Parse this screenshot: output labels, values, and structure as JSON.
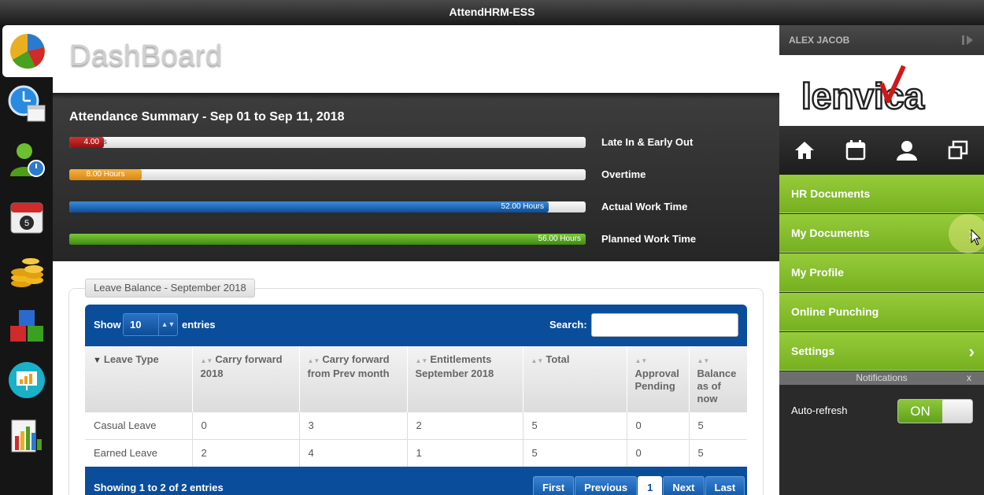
{
  "window": {
    "title": "AttendHRM-ESS"
  },
  "rail": {
    "items": [
      {
        "name": "dashboard-pie-icon"
      },
      {
        "name": "attendance-clock-icon"
      },
      {
        "name": "user-time-icon"
      },
      {
        "name": "calendar-icon"
      },
      {
        "name": "coins-icon"
      },
      {
        "name": "cubes-icon"
      },
      {
        "name": "presentation-icon"
      },
      {
        "name": "reports-chart-icon"
      }
    ]
  },
  "main": {
    "title": "DashBoard",
    "summary": {
      "title": "Attendance Summary - Sep 01 to Sep 11, 2018",
      "bars": [
        {
          "label": "Late In & Early Out",
          "value_text": "4.00",
          "ghost_text": "urs",
          "fraction": 0.045,
          "color": "#b01c1c"
        },
        {
          "label": "Overtime",
          "value_text": "8.00 Hours",
          "fraction": 0.14,
          "color": "#e89a20"
        },
        {
          "label": "Actual Work Time",
          "value_text": "52.00 Hours",
          "fraction": 0.928,
          "color": "#1660b8"
        },
        {
          "label": "Planned Work Time",
          "value_text": "56.00 Hours",
          "fraction": 1.0,
          "color": "#5aa820"
        }
      ]
    },
    "leave_balance": {
      "legend": "Leave Balance - September 2018",
      "show_label": "Show",
      "page_size": "10",
      "entries_label": "entries",
      "search_label": "Search:",
      "search_value": "",
      "columns": [
        "Leave Type",
        "Carry forward 2018",
        "Carry forward from Prev month",
        "Entitlements September 2018",
        "Total",
        "Approval Pending",
        "Balance as of now"
      ],
      "rows": [
        [
          "Casual Leave",
          "0",
          "3",
          "2",
          "5",
          "0",
          "5"
        ],
        [
          "Earned Leave",
          "2",
          "4",
          "1",
          "5",
          "0",
          "5"
        ]
      ],
      "footer_info": "Showing 1 to 2 of 2 entries",
      "pager": {
        "first": "First",
        "previous": "Previous",
        "current": "1",
        "next": "Next",
        "last": "Last"
      }
    }
  },
  "side": {
    "user_name": "ALEX JACOB",
    "logo_text": "lenvica",
    "nav": [
      {
        "label": "HR Documents",
        "chevron": ""
      },
      {
        "label": "My Documents",
        "chevron": "›"
      },
      {
        "label": "My Profile",
        "chevron": ""
      },
      {
        "label": "Online Punching",
        "chevron": ""
      },
      {
        "label": "Settings",
        "chevron": "›"
      }
    ],
    "notifications_label": "Notifications",
    "notifications_close": "x",
    "autorefresh_label": "Auto-refresh",
    "autorefresh_state": "ON"
  }
}
